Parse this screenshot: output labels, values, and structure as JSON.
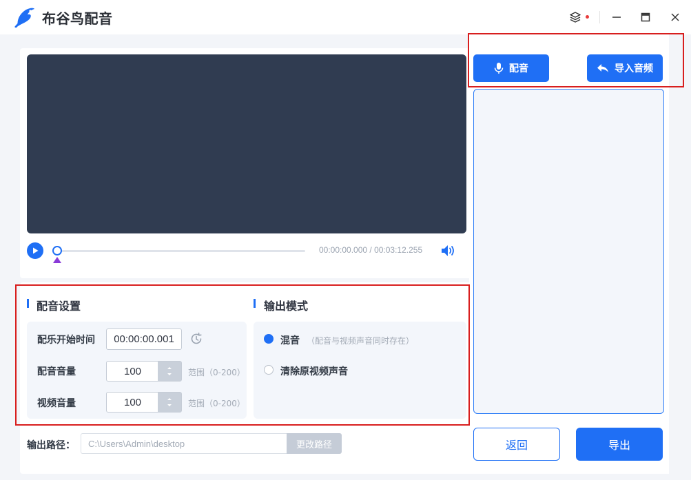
{
  "app": {
    "title": "布谷鸟配音"
  },
  "player": {
    "time": "00:00:00.000 / 00:03:12.255",
    "progress": 0
  },
  "dub_settings": {
    "heading": "配音设置",
    "start_label": "配乐开始时间",
    "start_value": "00:00:00.001",
    "dub_volume_label": "配音音量",
    "dub_volume_value": "100",
    "video_volume_label": "视频音量",
    "video_volume_value": "100",
    "range_hint": "范围（0-200）"
  },
  "output_mode": {
    "heading": "输出模式",
    "options": [
      {
        "label": "混音",
        "hint": "（配音与视频声音同时存在）",
        "selected": true
      },
      {
        "label": "清除原视频声音",
        "hint": "",
        "selected": false
      }
    ]
  },
  "output_path": {
    "label": "输出路径：",
    "value": "C:\\Users\\Admin\\desktop",
    "change_button": "更改路径"
  },
  "right_panel": {
    "dub_button": "配音",
    "import_button": "导入音频",
    "back_button": "返回",
    "export_button": "导出"
  },
  "colors": {
    "accent": "#1f6ff5",
    "video_bg": "#303c51",
    "highlight": "#d81e1e",
    "marker": "#8a3ad8"
  },
  "icons": [
    "app-logo-icon",
    "layers-icon",
    "minimize-icon",
    "maximize-icon",
    "close-icon",
    "play-icon",
    "volume-icon",
    "clock-reset-icon",
    "mic-icon",
    "import-arrow-icon"
  ]
}
